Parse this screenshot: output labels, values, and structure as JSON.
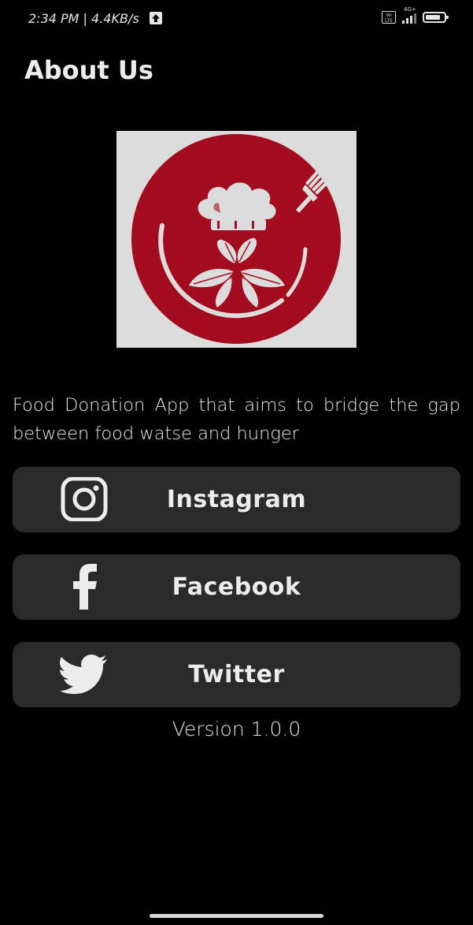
{
  "status_bar": {
    "time": "2:34 PM | 4.4KB/s",
    "network_type": "4G+",
    "volte_label": "Vo LTE"
  },
  "header": {
    "title": "About Us"
  },
  "logo": {
    "icon": "chef-hat-leaves-fork-logo",
    "colors": {
      "circle": "#a30b1e",
      "background": "#dcdcdc"
    }
  },
  "main": {
    "description": "Food Donation App that aims to bridge the gap between food watse and hunger",
    "social_links": [
      {
        "label": "Instagram",
        "icon": "instagram-icon"
      },
      {
        "label": "Facebook",
        "icon": "facebook-icon"
      },
      {
        "label": "Twitter",
        "icon": "twitter-icon"
      }
    ],
    "version": "Version 1.0.0"
  },
  "theme": {
    "background": "#000000",
    "button_background": "#2a2a2a",
    "text": "#ececec"
  }
}
